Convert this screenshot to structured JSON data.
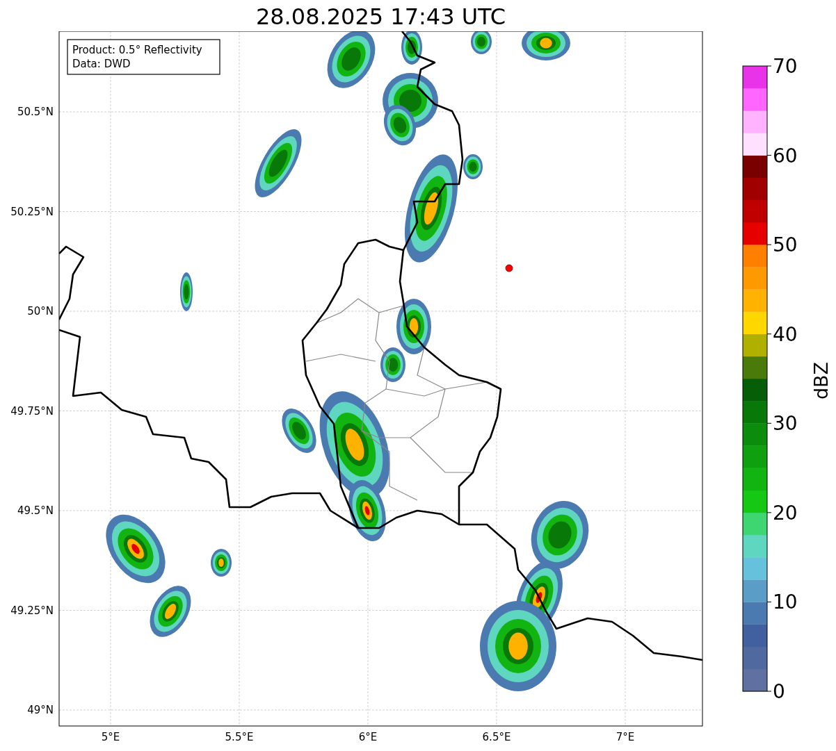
{
  "title": "28.08.2025 17:43 UTC",
  "legend": {
    "lines": [
      "Product: 0.5° Reflectivity",
      "Data: DWD"
    ]
  },
  "map": {
    "xticks": [
      "5°E",
      "5.5°E",
      "6°E",
      "6.5°E",
      "7°E"
    ],
    "yticks": [
      "50.5°N",
      "50.25°N",
      "50°N",
      "49.75°N",
      "49.5°N",
      "49.25°N",
      "49°N"
    ]
  },
  "colorbar": {
    "label": "dBZ",
    "ticks": [
      "70",
      "60",
      "50",
      "40",
      "30",
      "20",
      "10",
      "0"
    ],
    "bins": [
      {
        "color": "#6070a0"
      },
      {
        "color": "#506aa0"
      },
      {
        "color": "#4060a0"
      },
      {
        "color": "#4a7ab0"
      },
      {
        "color": "#5a9ec8"
      },
      {
        "color": "#66c2dc"
      },
      {
        "color": "#5fd6c0"
      },
      {
        "color": "#3dd670"
      },
      {
        "color": "#14c814"
      },
      {
        "color": "#12b412"
      },
      {
        "color": "#0ea00e"
      },
      {
        "color": "#0c8c0c"
      },
      {
        "color": "#087808"
      },
      {
        "color": "#065e06"
      },
      {
        "color": "#4a7a0a"
      },
      {
        "color": "#b0b000"
      },
      {
        "color": "#ffd700"
      },
      {
        "color": "#ffb300"
      },
      {
        "color": "#ff9900"
      },
      {
        "color": "#ff8000"
      },
      {
        "color": "#e60000"
      },
      {
        "color": "#c00000"
      },
      {
        "color": "#a00000"
      },
      {
        "color": "#7a0000"
      },
      {
        "color": "#ffe0ff"
      },
      {
        "color": "#ffb3ff"
      },
      {
        "color": "#ff66ff"
      },
      {
        "color": "#e833e8"
      }
    ]
  }
}
